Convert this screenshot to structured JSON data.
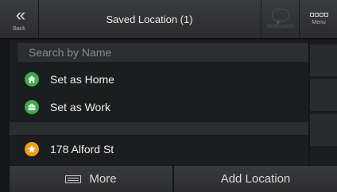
{
  "header": {
    "back_label": "Back",
    "title": "Saved Location (1)",
    "notification_label": "Notification",
    "menu_label": "Menu"
  },
  "search": {
    "placeholder": "Search by Name"
  },
  "items": [
    {
      "label": "Set as Home",
      "icon": "home-icon",
      "color": "#3eaa4c"
    },
    {
      "label": "Set as Work",
      "icon": "briefcase-icon",
      "color": "#3eaa4c"
    },
    {
      "label": "178 Alford St",
      "icon": "star-icon",
      "color": "#e8a21e"
    }
  ],
  "footer": {
    "more_label": "More",
    "add_label": "Add Location"
  }
}
